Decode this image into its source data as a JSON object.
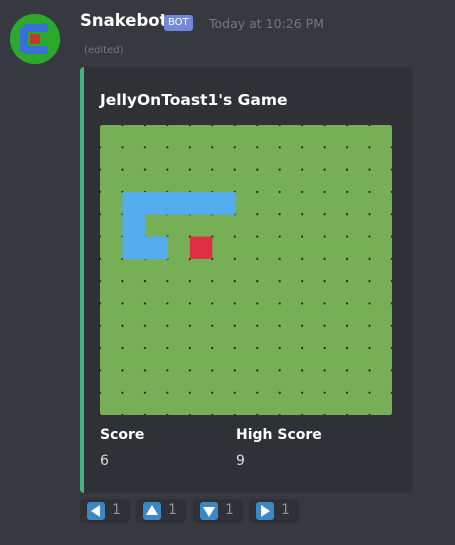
{
  "message": {
    "username": "Snakebot",
    "bot_tag": "BOT",
    "timestamp": "Today at 10:26 PM",
    "edited_label": "(edited)"
  },
  "embed": {
    "accent_color": "#43b581",
    "title": "JellyOnToast1's Game",
    "board": {
      "columns": 13,
      "rows": 13,
      "background": "#77af56",
      "snake_color": "#55acee",
      "food_color": "#dd2e44",
      "snake_cells": [
        [
          1,
          3
        ],
        [
          2,
          3
        ],
        [
          3,
          3
        ],
        [
          4,
          3
        ],
        [
          5,
          3
        ],
        [
          1,
          4
        ],
        [
          1,
          5
        ],
        [
          2,
          5
        ]
      ],
      "food_cell": [
        4,
        5
      ]
    },
    "fields": [
      {
        "name": "Score",
        "value": "6"
      },
      {
        "name": "High Score",
        "value": "9"
      }
    ]
  },
  "reactions": [
    {
      "emoji": "arrow-left-icon",
      "count": "1"
    },
    {
      "emoji": "arrow-up-icon",
      "count": "1"
    },
    {
      "emoji": "arrow-down-icon",
      "count": "1"
    },
    {
      "emoji": "arrow-right-icon",
      "count": "1"
    }
  ]
}
